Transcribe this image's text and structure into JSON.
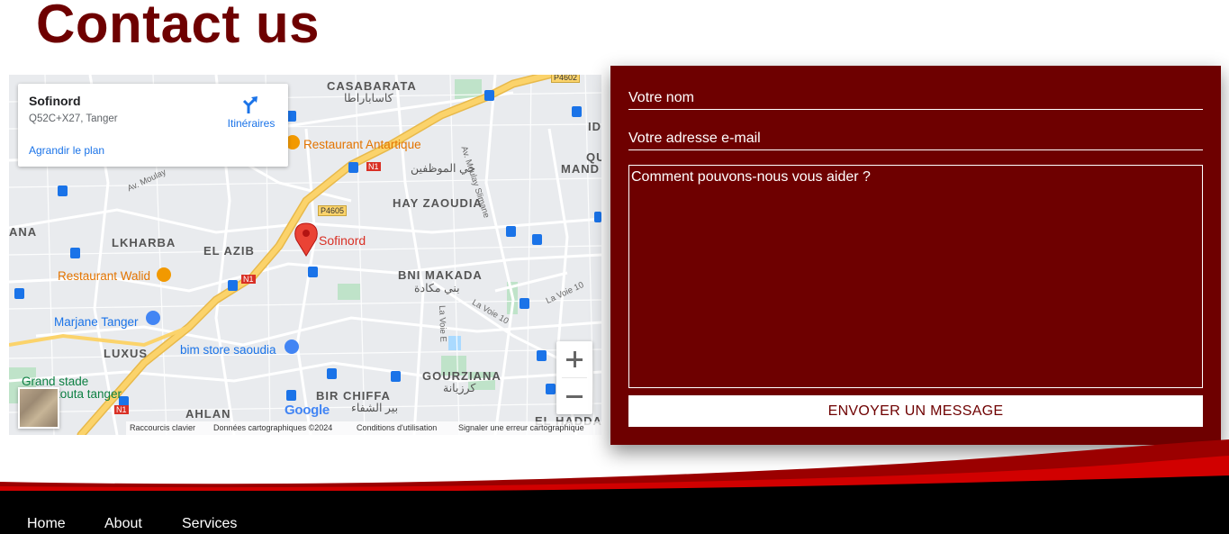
{
  "page": {
    "title": "Contact us"
  },
  "map": {
    "place_card": {
      "name": "Sofinord",
      "address": "Q52C+X27, Tanger",
      "directions_label": "Itinéraires",
      "enlarge_label": "Agrandir le plan",
      "directions_icon": "directions-icon"
    },
    "areas": {
      "casabarata": "CASABARATA",
      "casabarata_ar": "كاساباراطا",
      "hay_zaoudia": "HAY ZAOUDIA",
      "lkharba": "LKHARBA",
      "el_azib": "EL AZIB",
      "bni_makada": "BNI MAKADA",
      "bni_makada_ar": "بني مكادة",
      "luxus": "LUXUS",
      "gourziana": "GOURZIANA",
      "gourziana_ar": "كرزيانة",
      "bir_chiffa": "BIR CHIFFA",
      "bir_chiffa_ar": "بير الشفاء",
      "ahlan": "AHLAN",
      "el_haddad": "EL HADDAI",
      "hay_moutadafin_ar": "حي الموظفين",
      "ana": "ANA",
      "idr": "IDR",
      "qu": "QU",
      "manda": "MAND"
    },
    "roads": {
      "n1_a": "N1",
      "n1_b": "N1",
      "n1_c": "N1",
      "p4605": "P4605",
      "p4602": "P4602",
      "av_moulay": "Av. Moulay",
      "av_moulay_slimane": "Av. Moulay Slimane",
      "la_voie_10_a": "La Voie 10",
      "la_voie_10_b": "La Voie 10",
      "la_voie_e": "La Voie E"
    },
    "pois": {
      "restaurant_antartique": "Restaurant Antartique",
      "restaurant_walid": "Restaurant Walid",
      "marjane_tanger": "Marjane Tanger",
      "bim_store": "bim store saoudia",
      "grand_stade": "Grand stade",
      "grand_stade_2": "touta tanger",
      "sofinord_marker": "Sofinord"
    },
    "google_logo": "Google",
    "footer": {
      "shortcuts": "Raccourcis clavier",
      "map_data": "Données cartographiques ©2024",
      "terms": "Conditions d'utilisation",
      "report": "Signaler une erreur cartographique"
    },
    "colors": {
      "road": "#ffffff",
      "highway": "#fbd36b",
      "park": "#bfe3c9",
      "water": "#aadaff",
      "marker": "#ea4335"
    }
  },
  "form": {
    "name_placeholder": "Votre nom",
    "email_placeholder": "Votre adresse e-mail",
    "message_placeholder": "Comment pouvons-nous vous aider ?",
    "submit_label": "ENVOYER UN MESSAGE",
    "colors": {
      "panel": "#6e0000",
      "button_text": "#6e0000"
    }
  },
  "nav": {
    "items": [
      {
        "label": "Home"
      },
      {
        "label": "About"
      },
      {
        "label": "Services"
      }
    ]
  },
  "colors": {
    "brand": "#6e0000",
    "wave_red": "#b30000",
    "nav_bg": "#000000"
  }
}
